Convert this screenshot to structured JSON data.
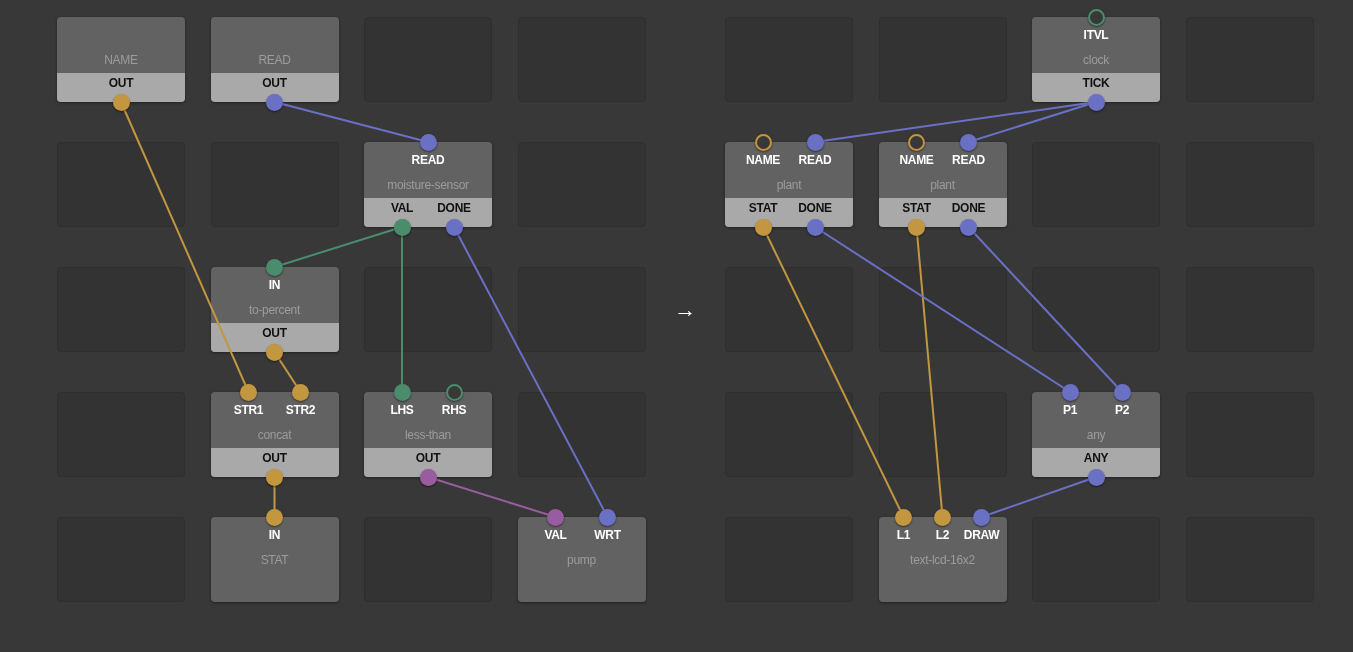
{
  "canvases": [
    {
      "rows": [
        {
          "cells": [
            {
              "kind": "node",
              "type": "NAME",
              "outputs": [
                {
                  "label": "OUT",
                  "color": "#c39640",
                  "linked": true
                }
              ]
            },
            {
              "kind": "node",
              "type": "READ",
              "outputs": [
                {
                  "label": "OUT",
                  "color": "#6a70c4",
                  "linked": true
                }
              ]
            },
            {
              "kind": "empty"
            },
            {
              "kind": "empty"
            }
          ]
        },
        {
          "cells": [
            {
              "kind": "empty"
            },
            {
              "kind": "empty"
            },
            {
              "kind": "node",
              "type": "moisture-sensor",
              "inputs": [
                {
                  "label": "READ",
                  "color": "#6a70c4",
                  "linked": true
                }
              ],
              "outputs": [
                {
                  "label": "VAL",
                  "color": "#4a8c6c",
                  "linked": true
                },
                {
                  "label": "DONE",
                  "color": "#6a70c4",
                  "linked": true
                }
              ]
            },
            {
              "kind": "empty"
            }
          ]
        },
        {
          "cells": [
            {
              "kind": "empty"
            },
            {
              "kind": "node",
              "type": "to-percent",
              "inputs": [
                {
                  "label": "IN",
                  "color": "#4a8c6c",
                  "linked": true
                }
              ],
              "outputs": [
                {
                  "label": "OUT",
                  "color": "#c39640",
                  "linked": true
                }
              ]
            },
            {
              "kind": "empty"
            },
            {
              "kind": "empty"
            }
          ]
        },
        {
          "cells": [
            {
              "kind": "empty"
            },
            {
              "kind": "node",
              "type": "concat",
              "inputs": [
                {
                  "label": "STR1",
                  "color": "#c39640",
                  "linked": true
                },
                {
                  "label": "STR2",
                  "color": "#c39640",
                  "linked": true
                }
              ],
              "outputs": [
                {
                  "label": "OUT",
                  "color": "#c39640",
                  "linked": true
                }
              ]
            },
            {
              "kind": "node",
              "type": "less-than",
              "inputs": [
                {
                  "label": "LHS",
                  "color": "#4a8c6c",
                  "linked": true
                },
                {
                  "label": "RHS",
                  "color": "#4a8c6c",
                  "linked": false
                }
              ],
              "outputs": [
                {
                  "label": "OUT",
                  "color": "#9a5ca0",
                  "linked": true
                }
              ]
            },
            {
              "kind": "empty"
            }
          ]
        },
        {
          "cells": [
            {
              "kind": "empty"
            },
            {
              "kind": "node",
              "type": "STAT",
              "inputs": [
                {
                  "label": "IN",
                  "color": "#c39640",
                  "linked": true
                }
              ]
            },
            {
              "kind": "empty"
            },
            {
              "kind": "node",
              "type": "pump",
              "inputs": [
                {
                  "label": "VAL",
                  "color": "#9a5ca0",
                  "linked": true
                },
                {
                  "label": "WRT",
                  "color": "#6a70c4",
                  "linked": true
                }
              ]
            }
          ]
        }
      ]
    },
    {
      "rows": [
        {
          "cells": [
            {
              "kind": "empty"
            },
            {
              "kind": "empty"
            },
            {
              "kind": "node",
              "type": "clock",
              "inputs": [
                {
                  "label": "ITVL",
                  "color": "#4a8c6c",
                  "linked": false
                }
              ],
              "outputs": [
                {
                  "label": "TICK",
                  "color": "#6a70c4",
                  "linked": true
                }
              ]
            },
            {
              "kind": "empty"
            }
          ]
        },
        {
          "cells": [
            {
              "kind": "node",
              "type": "plant",
              "inputs": [
                {
                  "label": "NAME",
                  "color": "#c39640",
                  "linked": false
                },
                {
                  "label": "READ",
                  "color": "#6a70c4",
                  "linked": true
                }
              ],
              "outputs": [
                {
                  "label": "STAT",
                  "color": "#c39640",
                  "linked": true
                },
                {
                  "label": "DONE",
                  "color": "#6a70c4",
                  "linked": true
                }
              ]
            },
            {
              "kind": "node",
              "type": "plant",
              "inputs": [
                {
                  "label": "NAME",
                  "color": "#c39640",
                  "linked": false
                },
                {
                  "label": "READ",
                  "color": "#6a70c4",
                  "linked": true
                }
              ],
              "outputs": [
                {
                  "label": "STAT",
                  "color": "#c39640",
                  "linked": true
                },
                {
                  "label": "DONE",
                  "color": "#6a70c4",
                  "linked": true
                }
              ]
            },
            {
              "kind": "empty"
            },
            {
              "kind": "empty"
            }
          ]
        },
        {
          "cells": [
            {
              "kind": "empty"
            },
            {
              "kind": "empty"
            },
            {
              "kind": "empty"
            },
            {
              "kind": "empty"
            }
          ]
        },
        {
          "cells": [
            {
              "kind": "empty"
            },
            {
              "kind": "empty"
            },
            {
              "kind": "node",
              "type": "any",
              "inputs": [
                {
                  "label": "P1",
                  "color": "#6a70c4",
                  "linked": true
                },
                {
                  "label": "P2",
                  "color": "#6a70c4",
                  "linked": true
                }
              ],
              "outputs": [
                {
                  "label": "ANY",
                  "color": "#6a70c4",
                  "linked": true
                }
              ]
            },
            {
              "kind": "empty"
            }
          ]
        },
        {
          "cells": [
            {
              "kind": "empty"
            },
            {
              "kind": "node",
              "type": "text-lcd-16x2",
              "inputs": [
                {
                  "label": "L1",
                  "color": "#c39640",
                  "linked": true
                },
                {
                  "label": "L2",
                  "color": "#c39640",
                  "linked": true
                },
                {
                  "label": "DRAW",
                  "color": "#6a70c4",
                  "linked": true
                }
              ]
            },
            {
              "kind": "empty"
            },
            {
              "kind": "empty"
            }
          ]
        }
      ]
    }
  ],
  "arrow": "→"
}
